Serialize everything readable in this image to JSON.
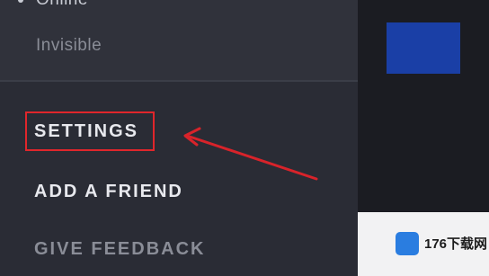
{
  "status_menu": {
    "online_label": "Online",
    "invisible_label": "Invisible"
  },
  "menu": {
    "items": [
      {
        "label": "SETTINGS",
        "highlighted": true
      },
      {
        "label": "ADD A FRIEND"
      },
      {
        "label": "GIVE FEEDBACK"
      }
    ]
  },
  "watermark": {
    "logo_text": "176下载网"
  },
  "colors": {
    "highlight": "#e0262b",
    "accent_blue": "#1a3fa6"
  }
}
